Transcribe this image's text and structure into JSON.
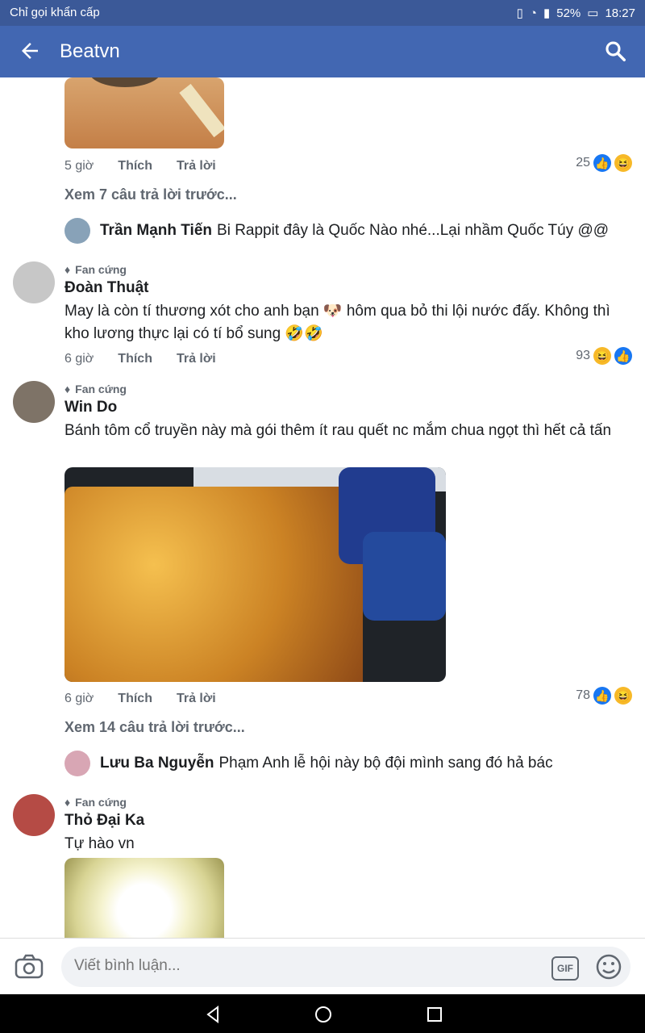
{
  "status_bar": {
    "carrier": "Chỉ gọi khẩn cấp",
    "battery": "52%",
    "time": "18:27"
  },
  "header": {
    "title": "Beatvn"
  },
  "comments": [
    {
      "time": "5 giờ",
      "like": "Thích",
      "reply": "Trả lời",
      "reactions": "25"
    },
    {
      "view_previous": "Xem 7 câu trả lời trước...",
      "reply_name": "Trần Mạnh Tiến",
      "reply_text": "Bi Rappit đây là Quốc Nào nhé...Lại nhầm Quốc Túy @@"
    },
    {
      "badge": "Fan cứng",
      "name": "Đoàn Thuật",
      "text": "May là còn tí thương xót cho anh bạn 🐶 hôm qua bỏ thi lội nước đấy. Không thì kho lương thực lại có tí bổ sung 🤣🤣",
      "time": "6 giờ",
      "like": "Thích",
      "reply": "Trả lời",
      "reactions": "93"
    },
    {
      "badge": "Fan cứng",
      "name": "Win Do",
      "text": "Bánh tôm cổ truyền này mà gói thêm ít rau quết nc mắm chua ngọt thì hết cả tấn",
      "time": "6 giờ",
      "like": "Thích",
      "reply": "Trả lời",
      "reactions": "78"
    },
    {
      "view_previous": "Xem 14 câu trả lời trước...",
      "reply_name": "Lưu Ba Nguyễn",
      "reply_text": "Phạm Anh lễ hội này bộ đội mình sang đó hả bác"
    },
    {
      "badge": "Fan cứng",
      "name": "Thỏ Đại Ka",
      "text": "Tự hào vn"
    }
  ],
  "composer": {
    "placeholder": "Viết bình luận...",
    "gif": "GIF"
  }
}
